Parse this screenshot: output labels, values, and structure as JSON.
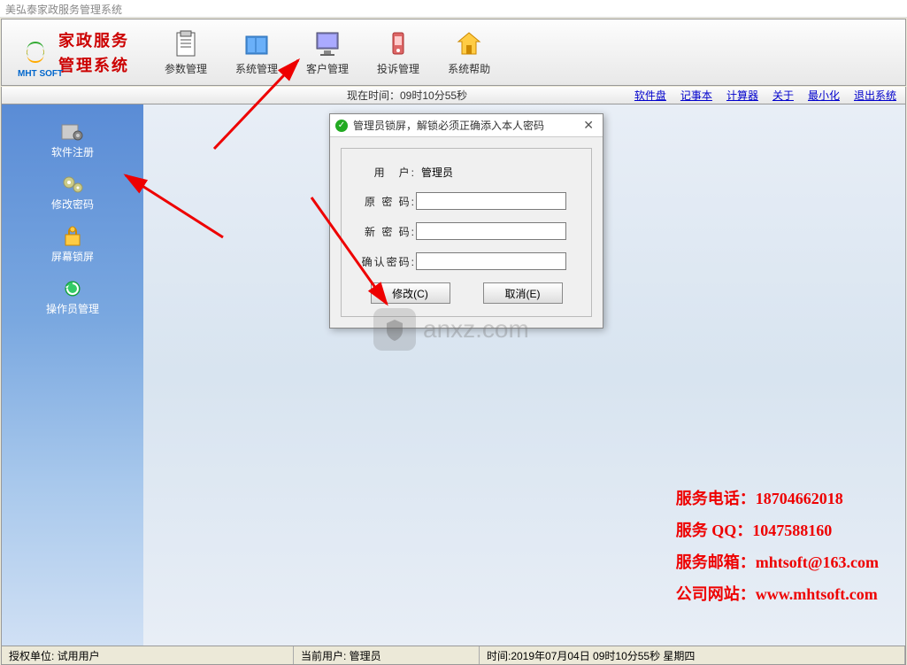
{
  "window": {
    "title": "美弘泰家政服务管理系统"
  },
  "logo": {
    "line1": "家政服务",
    "line2": "管理系统",
    "sub": "MHT SOFT"
  },
  "toolbar": {
    "items": [
      {
        "label": "参数管理",
        "icon": "clipboard"
      },
      {
        "label": "系统管理",
        "icon": "folder"
      },
      {
        "label": "客户管理",
        "icon": "monitor"
      },
      {
        "label": "投诉管理",
        "icon": "phone"
      },
      {
        "label": "系统帮助",
        "icon": "home"
      }
    ]
  },
  "infobar": {
    "time": "现在时间：09时10分55秒",
    "links": [
      "软件盘",
      "记事本",
      "计算器",
      "关于",
      "最小化",
      "退出系统"
    ]
  },
  "sidebar": {
    "items": [
      {
        "label": "软件注册"
      },
      {
        "label": "修改密码"
      },
      {
        "label": "屏幕锁屏"
      },
      {
        "label": "操作员管理"
      }
    ]
  },
  "dialog": {
    "title": "管理员锁屏，解锁必须正确添入本人密码",
    "user_label": "用　户:",
    "user_value": "管理员",
    "old_pwd_label": "原 密 码:",
    "new_pwd_label": "新 密 码:",
    "confirm_pwd_label": "确认密码:",
    "modify_btn": "修改(C)",
    "cancel_btn": "取消(E)"
  },
  "watermark": {
    "text": "anxz.com"
  },
  "contact": {
    "phone": "服务电话：18704662018",
    "qq": "服务 QQ：1047588160",
    "email": "服务邮箱：mhtsoft@163.com",
    "site": "公司网站：www.mhtsoft.com"
  },
  "statusbar": {
    "license": "授权单位: 试用用户",
    "user": "当前用户: 管理员",
    "time": "时间:2019年07月04日 09时10分55秒 星期四"
  }
}
